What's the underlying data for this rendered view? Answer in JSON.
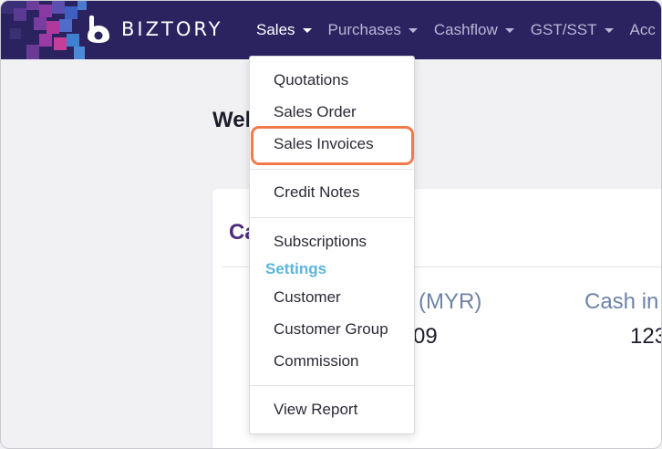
{
  "brand": {
    "name": "BIZTORY"
  },
  "nav": {
    "items": [
      {
        "label": "Sales",
        "active": true
      },
      {
        "label": "Purchases",
        "active": false
      },
      {
        "label": "Cashflow",
        "active": false
      },
      {
        "label": "GST/SST",
        "active": false
      },
      {
        "label": "Acc",
        "active": false
      }
    ]
  },
  "page": {
    "welcome": "Wel",
    "card_title": "Ca",
    "stat1_label": "(MYR)",
    "stat1_value": "09",
    "stat2_label": "Cash in",
    "stat2_value": "123"
  },
  "dropdown": {
    "items": [
      "Quotations",
      "Sales Order",
      "Sales Invoices",
      "Credit Notes",
      "Subscriptions"
    ],
    "settings_heading": "Settings",
    "settings_items": [
      "Customer",
      "Customer Group",
      "Commission"
    ],
    "report": "View Report",
    "highlighted": "Sales Invoices"
  },
  "colors": {
    "navbar": "#2a2360",
    "accent_purple": "#4d2c7d",
    "settings_blue": "#5bb5dc",
    "highlight_orange": "#f07a4a",
    "stat_label": "#6f83a6"
  }
}
